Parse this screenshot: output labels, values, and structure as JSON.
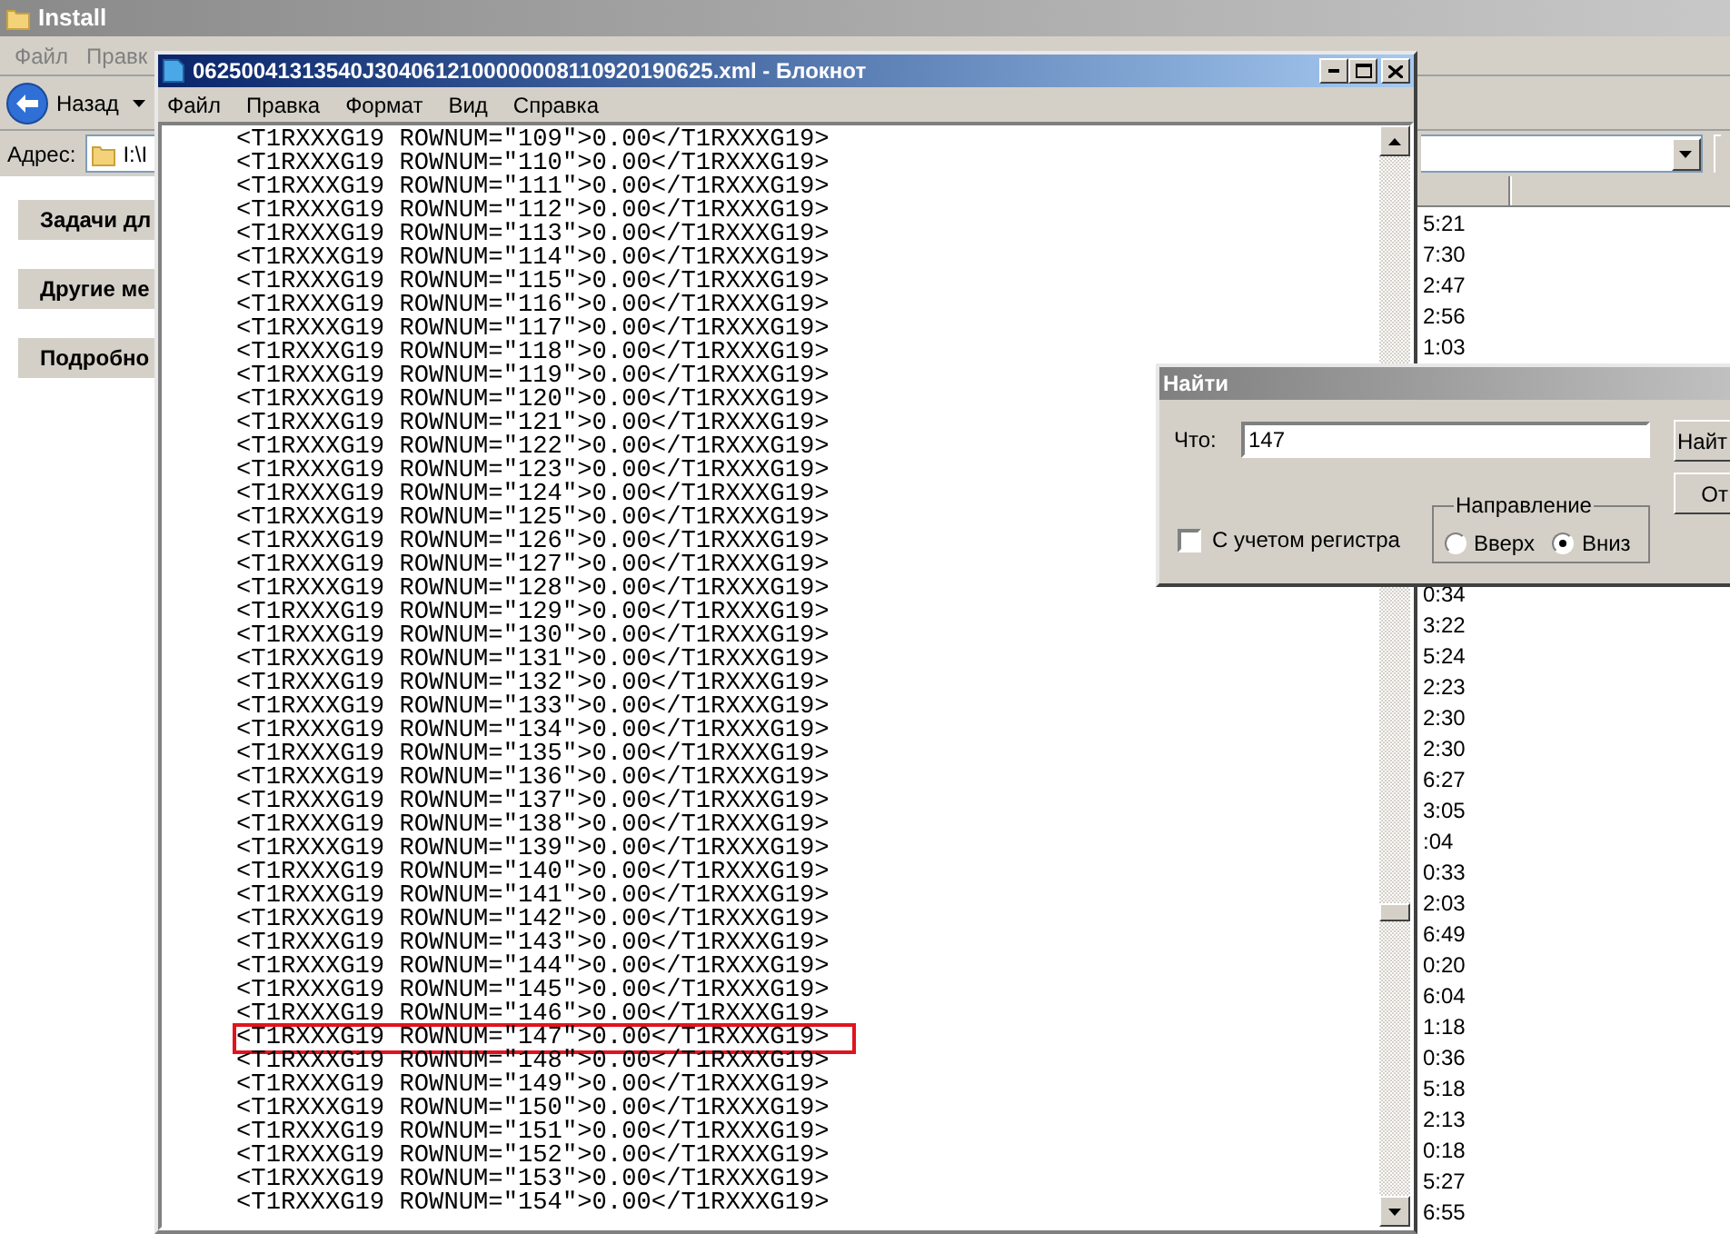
{
  "explorer": {
    "title": "Install",
    "menu": [
      "Файл",
      "Правк"
    ],
    "back_button": "Назад",
    "address_label": "Адрес:",
    "address": "I:\\I",
    "task_panels": [
      "Задачи дл",
      "Другие ме",
      "Подробно"
    ],
    "times_top": [
      "5:21",
      "7:30",
      "2:47",
      "2:56",
      "1:03"
    ],
    "times_bottom": [
      "0:34",
      "3:22",
      "5:24",
      "2:23",
      "2:30",
      "2:30",
      "6:27",
      "3:05",
      ":04",
      "0:33",
      "2:03",
      "6:49",
      "0:20",
      "6:04",
      "1:18",
      "0:36",
      "5:18",
      "2:13",
      "0:18",
      "5:27",
      "6:55"
    ]
  },
  "notepad": {
    "title": "06250041313540J3040612100000008110920190625.xml - Блокнот",
    "menu": [
      "Файл",
      "Правка",
      "Формат",
      "Вид",
      "Справка"
    ],
    "lines": [
      {
        "text": "<T1RXXXG19 ROWNUM=\"109\">0.00</T1RXXXG19>",
        "highlighted": false
      },
      {
        "text": "<T1RXXXG19 ROWNUM=\"110\">0.00</T1RXXXG19>",
        "highlighted": false
      },
      {
        "text": "<T1RXXXG19 ROWNUM=\"111\">0.00</T1RXXXG19>",
        "highlighted": false
      },
      {
        "text": "<T1RXXXG19 ROWNUM=\"112\">0.00</T1RXXXG19>",
        "highlighted": false
      },
      {
        "text": "<T1RXXXG19 ROWNUM=\"113\">0.00</T1RXXXG19>",
        "highlighted": false
      },
      {
        "text": "<T1RXXXG19 ROWNUM=\"114\">0.00</T1RXXXG19>",
        "highlighted": false
      },
      {
        "text": "<T1RXXXG19 ROWNUM=\"115\">0.00</T1RXXXG19>",
        "highlighted": false
      },
      {
        "text": "<T1RXXXG19 ROWNUM=\"116\">0.00</T1RXXXG19>",
        "highlighted": false
      },
      {
        "text": "<T1RXXXG19 ROWNUM=\"117\">0.00</T1RXXXG19>",
        "highlighted": false
      },
      {
        "text": "<T1RXXXG19 ROWNUM=\"118\">0.00</T1RXXXG19>",
        "highlighted": false
      },
      {
        "text": "<T1RXXXG19 ROWNUM=\"119\">0.00</T1RXXXG19>",
        "highlighted": false
      },
      {
        "text": "<T1RXXXG19 ROWNUM=\"120\">0.00</T1RXXXG19>",
        "highlighted": false
      },
      {
        "text": "<T1RXXXG19 ROWNUM=\"121\">0.00</T1RXXXG19>",
        "highlighted": false
      },
      {
        "text": "<T1RXXXG19 ROWNUM=\"122\">0.00</T1RXXXG19>",
        "highlighted": false
      },
      {
        "text": "<T1RXXXG19 ROWNUM=\"123\">0.00</T1RXXXG19>",
        "highlighted": false
      },
      {
        "text": "<T1RXXXG19 ROWNUM=\"124\">0.00</T1RXXXG19>",
        "highlighted": false
      },
      {
        "text": "<T1RXXXG19 ROWNUM=\"125\">0.00</T1RXXXG19>",
        "highlighted": false
      },
      {
        "text": "<T1RXXXG19 ROWNUM=\"126\">0.00</T1RXXXG19>",
        "highlighted": false
      },
      {
        "text": "<T1RXXXG19 ROWNUM=\"127\">0.00</T1RXXXG19>",
        "highlighted": false
      },
      {
        "text": "<T1RXXXG19 ROWNUM=\"128\">0.00</T1RXXXG19>",
        "highlighted": false
      },
      {
        "text": "<T1RXXXG19 ROWNUM=\"129\">0.00</T1RXXXG19>",
        "highlighted": false
      },
      {
        "text": "<T1RXXXG19 ROWNUM=\"130\">0.00</T1RXXXG19>",
        "highlighted": false
      },
      {
        "text": "<T1RXXXG19 ROWNUM=\"131\">0.00</T1RXXXG19>",
        "highlighted": false
      },
      {
        "text": "<T1RXXXG19 ROWNUM=\"132\">0.00</T1RXXXG19>",
        "highlighted": false
      },
      {
        "text": "<T1RXXXG19 ROWNUM=\"133\">0.00</T1RXXXG19>",
        "highlighted": false
      },
      {
        "text": "<T1RXXXG19 ROWNUM=\"134\">0.00</T1RXXXG19>",
        "highlighted": false
      },
      {
        "text": "<T1RXXXG19 ROWNUM=\"135\">0.00</T1RXXXG19>",
        "highlighted": false
      },
      {
        "text": "<T1RXXXG19 ROWNUM=\"136\">0.00</T1RXXXG19>",
        "highlighted": false
      },
      {
        "text": "<T1RXXXG19 ROWNUM=\"137\">0.00</T1RXXXG19>",
        "highlighted": false
      },
      {
        "text": "<T1RXXXG19 ROWNUM=\"138\">0.00</T1RXXXG19>",
        "highlighted": false
      },
      {
        "text": "<T1RXXXG19 ROWNUM=\"139\">0.00</T1RXXXG19>",
        "highlighted": false
      },
      {
        "text": "<T1RXXXG19 ROWNUM=\"140\">0.00</T1RXXXG19>",
        "highlighted": false
      },
      {
        "text": "<T1RXXXG19 ROWNUM=\"141\">0.00</T1RXXXG19>",
        "highlighted": false
      },
      {
        "text": "<T1RXXXG19 ROWNUM=\"142\">0.00</T1RXXXG19>",
        "highlighted": false
      },
      {
        "text": "<T1RXXXG19 ROWNUM=\"143\">0.00</T1RXXXG19>",
        "highlighted": false
      },
      {
        "text": "<T1RXXXG19 ROWNUM=\"144\">0.00</T1RXXXG19>",
        "highlighted": false
      },
      {
        "text": "<T1RXXXG19 ROWNUM=\"145\">0.00</T1RXXXG19>",
        "highlighted": false
      },
      {
        "text": "<T1RXXXG19 ROWNUM=\"146\">0.00</T1RXXXG19>",
        "highlighted": false
      },
      {
        "text": "<T1RXXXG19 ROWNUM=\"147\">0.00</T1RXXXG19>",
        "highlighted": true
      },
      {
        "text": "<T1RXXXG19 ROWNUM=\"148\">0.00</T1RXXXG19>",
        "highlighted": false
      },
      {
        "text": "<T1RXXXG19 ROWNUM=\"149\">0.00</T1RXXXG19>",
        "highlighted": false
      },
      {
        "text": "<T1RXXXG19 ROWNUM=\"150\">0.00</T1RXXXG19>",
        "highlighted": false
      },
      {
        "text": "<T1RXXXG19 ROWNUM=\"151\">0.00</T1RXXXG19>",
        "highlighted": false
      },
      {
        "text": "<T1RXXXG19 ROWNUM=\"152\">0.00</T1RXXXG19>",
        "highlighted": false
      },
      {
        "text": "<T1RXXXG19 ROWNUM=\"153\">0.00</T1RXXXG19>",
        "highlighted": false
      },
      {
        "text": "<T1RXXXG19 ROWNUM=\"154\">0.00</T1RXXXG19>",
        "highlighted": false
      }
    ]
  },
  "find_dialog": {
    "title": "Найти",
    "what_label": "Что:",
    "what_value": "147",
    "buttons": [
      "Найт",
      "От"
    ],
    "match_case": {
      "label": "С учетом регистра",
      "checked": false
    },
    "direction_label": "Направление",
    "direction_options": [
      {
        "label": "Вверх",
        "selected": false
      },
      {
        "label": "Вниз",
        "selected": true
      }
    ]
  }
}
